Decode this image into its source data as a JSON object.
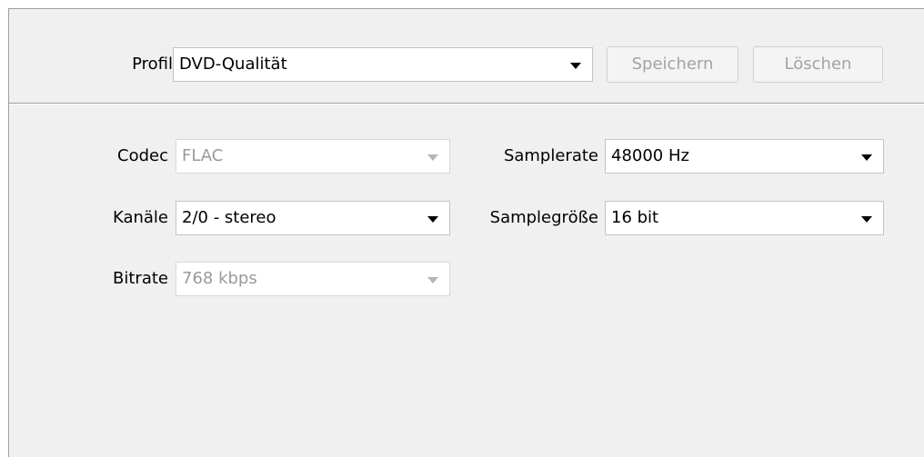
{
  "profile": {
    "label": "Profil",
    "value": "DVD-Qualität",
    "save_label": "Speichern",
    "delete_label": "Löschen"
  },
  "fields": {
    "codec": {
      "label": "Codec",
      "value": "FLAC",
      "enabled": false
    },
    "channels": {
      "label": "Kanäle",
      "value": "2/0 - stereo",
      "enabled": true
    },
    "bitrate": {
      "label": "Bitrate",
      "value": "768 kbps",
      "enabled": false
    },
    "samplerate": {
      "label": "Samplerate",
      "value": "48000 Hz",
      "enabled": true
    },
    "samplesize": {
      "label": "Samplegröße",
      "value": "16 bit",
      "enabled": true
    }
  },
  "icons": {
    "dropdown": "chevron-down-icon"
  },
  "colors": {
    "panel_bg": "#f0f0f0",
    "disabled_text": "#9a9a9a"
  }
}
